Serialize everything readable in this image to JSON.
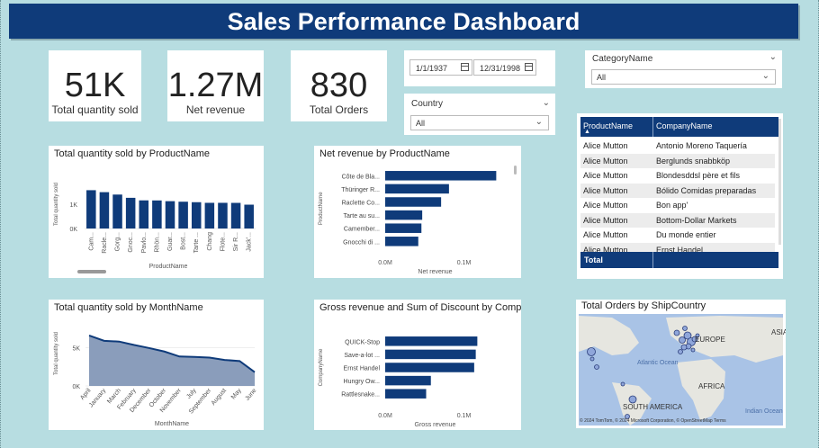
{
  "header": {
    "title": "Sales Performance Dashboard"
  },
  "kpis": [
    {
      "value": "51K",
      "label": "Total quantity sold"
    },
    {
      "value": "1.27M",
      "label": "Net revenue"
    },
    {
      "value": "830",
      "label": "Total Orders"
    }
  ],
  "date_slicer": {
    "start": "1/1/1937",
    "end": "12/31/1998"
  },
  "country_slicer": {
    "label": "Country",
    "value": "All"
  },
  "category_slicer": {
    "label": "CategoryName",
    "value": "All"
  },
  "table": {
    "columns": [
      "ProductName",
      "CompanyName"
    ],
    "rows": [
      [
        "Alice Mutton",
        "Antonio Moreno Taquería"
      ],
      [
        "Alice Mutton",
        "Berglunds snabbköp"
      ],
      [
        "Alice Mutton",
        "Blondesddsl père et fils"
      ],
      [
        "Alice Mutton",
        "Bólido Comidas preparadas"
      ],
      [
        "Alice Mutton",
        "Bon app'"
      ],
      [
        "Alice Mutton",
        "Bottom-Dollar Markets"
      ],
      [
        "Alice Mutton",
        "Du monde entier"
      ],
      [
        "Alice Mutton",
        "Ernst Handel"
      ]
    ],
    "total_label": "Total"
  },
  "map": {
    "title": "Total Orders by ShipCountry",
    "labels": [
      "EUROPE",
      "ASIA",
      "Atlantic Ocean",
      "AFRICA",
      "SOUTH AMERICA",
      "Indian Ocean"
    ],
    "attribution": "© 2024 TomTom, © 2024 Microsoft Corporation, © OpenStreetMap Terms"
  },
  "chart_data": [
    {
      "type": "bar",
      "title": "Total quantity sold by ProductName",
      "xlabel": "ProductName",
      "ylabel": "Total quantity sold",
      "ticks": [
        "0K",
        "1K"
      ],
      "ylim": [
        0,
        2000
      ],
      "categories": [
        "Cam...",
        "Racle...",
        "Gorg...",
        "Gnoc...",
        "Pavlo...",
        "Rhön...",
        "Guar...",
        "Bost...",
        "Tarte ...",
        "Chang",
        "Flote...",
        "Sir R...",
        "Jack'..."
      ],
      "values": [
        1577,
        1496,
        1397,
        1263,
        1158,
        1155,
        1125,
        1103,
        1083,
        1057,
        1057,
        1055,
        981
      ]
    },
    {
      "type": "bar",
      "orientation": "horizontal",
      "title": "Net revenue by ProductName",
      "xlabel": "Net revenue",
      "ylabel": "ProductName",
      "ticks": [
        "0.0M",
        "0.1M"
      ],
      "xlim": [
        0,
        0.16
      ],
      "categories": [
        "Côte de Bla...",
        "Thüringer R...",
        "Raclette Co...",
        "Tarte au su...",
        "Camember...",
        "Gnocchi di ..."
      ],
      "values": [
        0.141,
        0.081,
        0.071,
        0.047,
        0.046,
        0.042
      ]
    },
    {
      "type": "area",
      "title": "Total quantity sold by MonthName",
      "xlabel": "MonthName",
      "ylabel": "Total quantity sold",
      "ticks": [
        "0K",
        "5K"
      ],
      "ylim": [
        0,
        8000
      ],
      "categories": [
        "April",
        "January",
        "March",
        "February",
        "December",
        "October",
        "November",
        "July",
        "September",
        "August",
        "May",
        "June"
      ],
      "values": [
        6600,
        5900,
        5800,
        5350,
        4950,
        4500,
        3850,
        3800,
        3700,
        3400,
        3250,
        1800
      ]
    },
    {
      "type": "bar",
      "orientation": "horizontal",
      "title": "Gross revenue and Sum of Discount by CompanyName",
      "xlabel": "Gross revenue",
      "ylabel": "CompanyName",
      "ticks": [
        "0.0M",
        "0.1M"
      ],
      "xlim": [
        0,
        0.16
      ],
      "categories": [
        "QUICK-Stop",
        "Save-a-lot ...",
        "Ernst Handel",
        "Hungry Ow...",
        "Rattlesnake..."
      ],
      "values": [
        0.117,
        0.115,
        0.113,
        0.058,
        0.052
      ]
    }
  ]
}
